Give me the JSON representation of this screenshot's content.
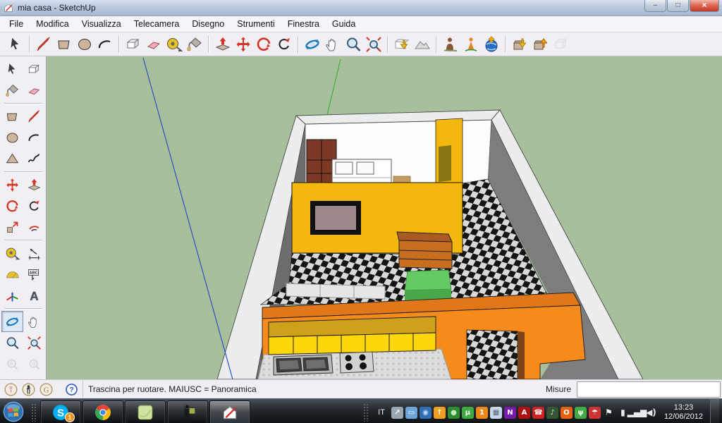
{
  "window": {
    "title": "mia casa - SketchUp",
    "app_icon": "sketchup",
    "controls": [
      {
        "name": "minimize",
        "glyph": "–"
      },
      {
        "name": "maximize",
        "glyph": "□"
      },
      {
        "name": "close",
        "glyph": "×"
      }
    ]
  },
  "menu_bar": {
    "items": [
      "File",
      "Modifica",
      "Visualizza",
      "Telecamera",
      "Disegno",
      "Strumenti",
      "Finestra",
      "Guida"
    ]
  },
  "toolbar": {
    "groups": [
      [
        {
          "name": "select"
        }
      ],
      [
        {
          "name": "line"
        },
        {
          "name": "rectangle"
        },
        {
          "name": "circle"
        },
        {
          "name": "arc"
        }
      ],
      [
        {
          "name": "make-component"
        },
        {
          "name": "eraser"
        },
        {
          "name": "tape-measure"
        },
        {
          "name": "paint-bucket"
        }
      ],
      [
        {
          "name": "push-pull"
        },
        {
          "name": "move"
        },
        {
          "name": "rotate"
        },
        {
          "name": "follow-me"
        }
      ],
      [
        {
          "name": "orbit"
        },
        {
          "name": "pan"
        },
        {
          "name": "zoom"
        },
        {
          "name": "zoom-extents"
        }
      ],
      [
        {
          "name": "get-current-view"
        },
        {
          "name": "toggle-terrain"
        }
      ],
      [
        {
          "name": "photo-textures"
        },
        {
          "name": "add-building"
        },
        {
          "name": "google-earth"
        }
      ],
      [
        {
          "name": "get-models"
        },
        {
          "name": "share-model"
        },
        {
          "name": "share-component",
          "disabled": true
        }
      ]
    ]
  },
  "tool_palette": {
    "rows": [
      {
        "icons": [
          {
            "name": "select"
          },
          {
            "name": "make-component"
          }
        ]
      },
      {
        "icons": [
          {
            "name": "paint-bucket"
          },
          {
            "name": "eraser"
          }
        ]
      },
      {
        "sep": true
      },
      {
        "icons": [
          {
            "name": "rectangle"
          },
          {
            "name": "line"
          }
        ]
      },
      {
        "icons": [
          {
            "name": "circle"
          },
          {
            "name": "arc"
          }
        ]
      },
      {
        "icons": [
          {
            "name": "polygon"
          },
          {
            "name": "freehand"
          }
        ]
      },
      {
        "sep": true
      },
      {
        "icons": [
          {
            "name": "move"
          },
          {
            "name": "push-pull"
          }
        ]
      },
      {
        "icons": [
          {
            "name": "rotate"
          },
          {
            "name": "follow-me"
          }
        ]
      },
      {
        "icons": [
          {
            "name": "scale"
          },
          {
            "name": "offset"
          }
        ]
      },
      {
        "sep": true
      },
      {
        "icons": [
          {
            "name": "tape-measure"
          },
          {
            "name": "dimension"
          }
        ]
      },
      {
        "icons": [
          {
            "name": "protractor"
          },
          {
            "name": "text"
          }
        ]
      },
      {
        "icons": [
          {
            "name": "axes"
          },
          {
            "name": "text-3d"
          }
        ]
      },
      {
        "sep": true
      },
      {
        "icons": [
          {
            "name": "orbit",
            "selected": true
          },
          {
            "name": "pan"
          }
        ]
      },
      {
        "icons": [
          {
            "name": "zoom"
          },
          {
            "name": "zoom-extents"
          }
        ]
      },
      {
        "icons": [
          {
            "name": "previous",
            "disabled": true
          },
          {
            "name": "next",
            "disabled": true
          }
        ]
      }
    ]
  },
  "statusbar": {
    "camera_tools": [
      "position-camera",
      "walk",
      "look-around"
    ],
    "help_icon": "help",
    "hint": "Trascina per ruotare.  MAIUSC = Panoramica",
    "measure_label": "Misure",
    "measure_value": ""
  },
  "taskbar": {
    "start": "start-orb",
    "apps": [
      {
        "name": "skype",
        "badge": "1"
      },
      {
        "name": "chrome"
      },
      {
        "name": "notes"
      },
      {
        "name": "camcorder"
      },
      {
        "name": "sketchup",
        "active": true
      }
    ],
    "language": "IT",
    "tray": [
      {
        "name": "remote-updates",
        "color": "#9aa8b4",
        "glyph": "↗",
        "fg": "#fff"
      },
      {
        "name": "folder",
        "color": "#6ea6dc",
        "glyph": "▭",
        "fg": "#fff"
      },
      {
        "name": "blue-wheel-app",
        "color": "#2f6fb8",
        "glyph": "◉",
        "fg": "#cde"
      },
      {
        "name": "orange-updater",
        "color": "#f0a020",
        "glyph": "↑",
        "fg": "#fff"
      },
      {
        "name": "green-player",
        "color": "#2e8b2e",
        "glyph": "●",
        "fg": "#bfe8bf"
      },
      {
        "name": "utorrent",
        "color": "#3faa3f",
        "glyph": "µ",
        "fg": "#fff"
      },
      {
        "name": "orange-badge",
        "color": "#f08818",
        "glyph": "1",
        "fg": "#fff"
      },
      {
        "name": "photo-viewer",
        "color": "#c8d8e8",
        "glyph": "▦",
        "fg": "#567"
      },
      {
        "name": "onenote",
        "color": "#7719aa",
        "glyph": "N",
        "fg": "#fff"
      },
      {
        "name": "adobe-reader",
        "color": "#b01212",
        "glyph": "A",
        "fg": "#fff"
      },
      {
        "name": "call-app",
        "color": "#cc2222",
        "glyph": "☎",
        "fg": "#fff"
      },
      {
        "name": "music-app",
        "color": "#335533",
        "glyph": "♪",
        "fg": "#cfe0cf"
      },
      {
        "name": "aimp",
        "color": "#e86010",
        "glyph": "O",
        "fg": "#fff"
      },
      {
        "name": "wireless-tool",
        "color": "#44aa44",
        "glyph": "ψ",
        "fg": "#eaffea"
      },
      {
        "name": "avira",
        "color": "#cc3333",
        "glyph": "☂",
        "fg": "#fff"
      },
      {
        "name": "action-center",
        "system": true,
        "glyph": "⚑",
        "fg": "#f2f4f6"
      },
      {
        "name": "battery",
        "system": true,
        "glyph": "▮",
        "fg": "#e8ecf0"
      },
      {
        "name": "network-signal",
        "system": true,
        "glyph": "▂▄▆",
        "fg": "#e8ecf0"
      },
      {
        "name": "volume",
        "system": true,
        "glyph": "◀)",
        "fg": "#e8ecf0"
      }
    ],
    "clock_time": "13:23",
    "clock_date": "12/06/2012"
  },
  "viewport": {
    "colors": {
      "sage": "#a8bf9b",
      "wallL": "#6d6d6d",
      "wallR": "#7d7d7d",
      "rim": "#ebedee",
      "rimStroke": "#4a4a4a",
      "white": "#fdfdfd",
      "gold": "#f3b70d",
      "goldDark": "#8a7414",
      "brown": "#7c3a26",
      "tvFrame": "#111111",
      "tvScreen": "#9e888c",
      "checkA": "#d9d9d9",
      "checkB": "#141414",
      "dresserTop": "#aa5a22",
      "dresserFront": "#c86f1f",
      "tableTop": "#64cb64",
      "tableSide": "#49a849",
      "orangeTop": "#e2771a",
      "orangeFront": "#f68b1b",
      "jamb": "#7a4416",
      "cabTop": "#cfa11b",
      "cabFront": "#ffd60a",
      "counter": "#dcdcdc",
      "counterDot": "#c2c2c2",
      "sinkOuter": "#b8b8b8",
      "sinkBasin": "#3f3f3f",
      "stove": "#d2d2d2",
      "burner": "#111111",
      "axisBlue": "#2b52c8",
      "axisGreen": "#3fae3f",
      "grayBoxes": "#e6e6e6",
      "bedWhite": "#ffffff",
      "tanItem": "#c49a62"
    }
  }
}
